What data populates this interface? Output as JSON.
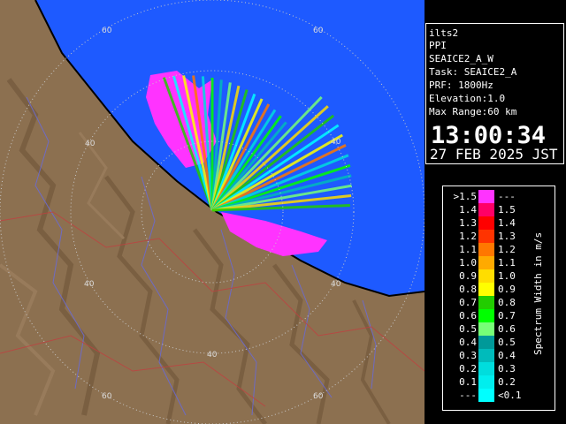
{
  "info": {
    "site": "ilts2",
    "product": "PPI",
    "scan": "SEAICE2_A_W",
    "task": "Task: SEAICE2_A",
    "prf": "PRF: 1800Hz",
    "elevation": "Elevation:1.0",
    "max_range": "Max Range:60 km",
    "time": "13:00:34",
    "date": "27 FEB 2025 JST"
  },
  "legend": {
    "unit": "Spectrum Width in m/s",
    "rows": [
      {
        "left": ">1.5",
        "right": "---",
        "color": "#ff33ff"
      },
      {
        "left": "1.4",
        "right": "1.5",
        "color": "#ff0066"
      },
      {
        "left": "1.3",
        "right": "1.4",
        "color": "#ff0000"
      },
      {
        "left": "1.2",
        "right": "1.3",
        "color": "#ff3300"
      },
      {
        "left": "1.1",
        "right": "1.2",
        "color": "#ff7700"
      },
      {
        "left": "1.0",
        "right": "1.1",
        "color": "#ffaa00"
      },
      {
        "left": "0.9",
        "right": "1.0",
        "color": "#ffdd00"
      },
      {
        "left": "0.8",
        "right": "0.9",
        "color": "#ffff00"
      },
      {
        "left": "0.7",
        "right": "0.8",
        "color": "#22cc00"
      },
      {
        "left": "0.6",
        "right": "0.7",
        "color": "#00ff00"
      },
      {
        "left": "0.5",
        "right": "0.6",
        "color": "#77ff77"
      },
      {
        "left": "0.4",
        "right": "0.5",
        "color": "#009999"
      },
      {
        "left": "0.3",
        "right": "0.4",
        "color": "#00bbbb"
      },
      {
        "left": "0.2",
        "right": "0.3",
        "color": "#00dddd"
      },
      {
        "left": "0.1",
        "right": "0.2",
        "color": "#00eeee"
      },
      {
        "left": "---",
        "right": "<0.1",
        "color": "#00ffff"
      }
    ]
  },
  "range_labels": [
    "40",
    "60"
  ],
  "colors": {
    "sea": "#1e5aff",
    "land": "#8c7050",
    "coast": "#000000",
    "ring": "#c8c8c8"
  }
}
